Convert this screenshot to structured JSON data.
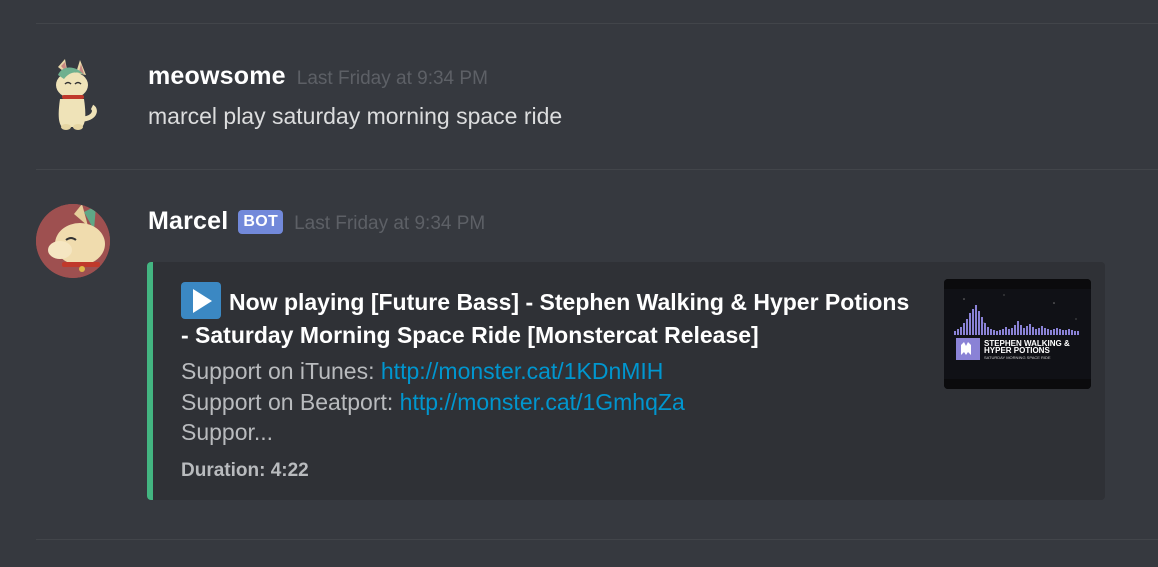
{
  "messages": [
    {
      "username": "meowsome",
      "timestamp": "Last Friday at 9:34 PM",
      "content": "marcel play saturday morning space ride"
    },
    {
      "username": "Marcel",
      "bot_tag": "BOT",
      "timestamp": "Last Friday at 9:34 PM",
      "embed": {
        "title": "Now playing [Future Bass] - Stephen Walking & Hyper Potions - Saturday Morning Space Ride [Monstercat Release]",
        "title_icon": "play-button-icon",
        "accent_color": "#43b581",
        "description": {
          "line1_prefix": "Support on iTunes: ",
          "line1_link": "http://monster.cat/1KDnMIH",
          "line2_prefix": "Support on Beatport: ",
          "line2_link": "http://monster.cat/1GmhqZa",
          "line3": "Suppor..."
        },
        "field": "Duration: 4:22",
        "thumbnail": {
          "text_line1": "STEPHEN WALKING &",
          "text_line2": "HYPER POTIONS",
          "text_line3": "SATURDAY MORNING SPACE RIDE"
        }
      }
    }
  ],
  "colors": {
    "background": "#36393f",
    "embed_background": "#2f3136",
    "link": "#0096cf",
    "bot_tag": "#7289da",
    "username": "#ffffff"
  }
}
